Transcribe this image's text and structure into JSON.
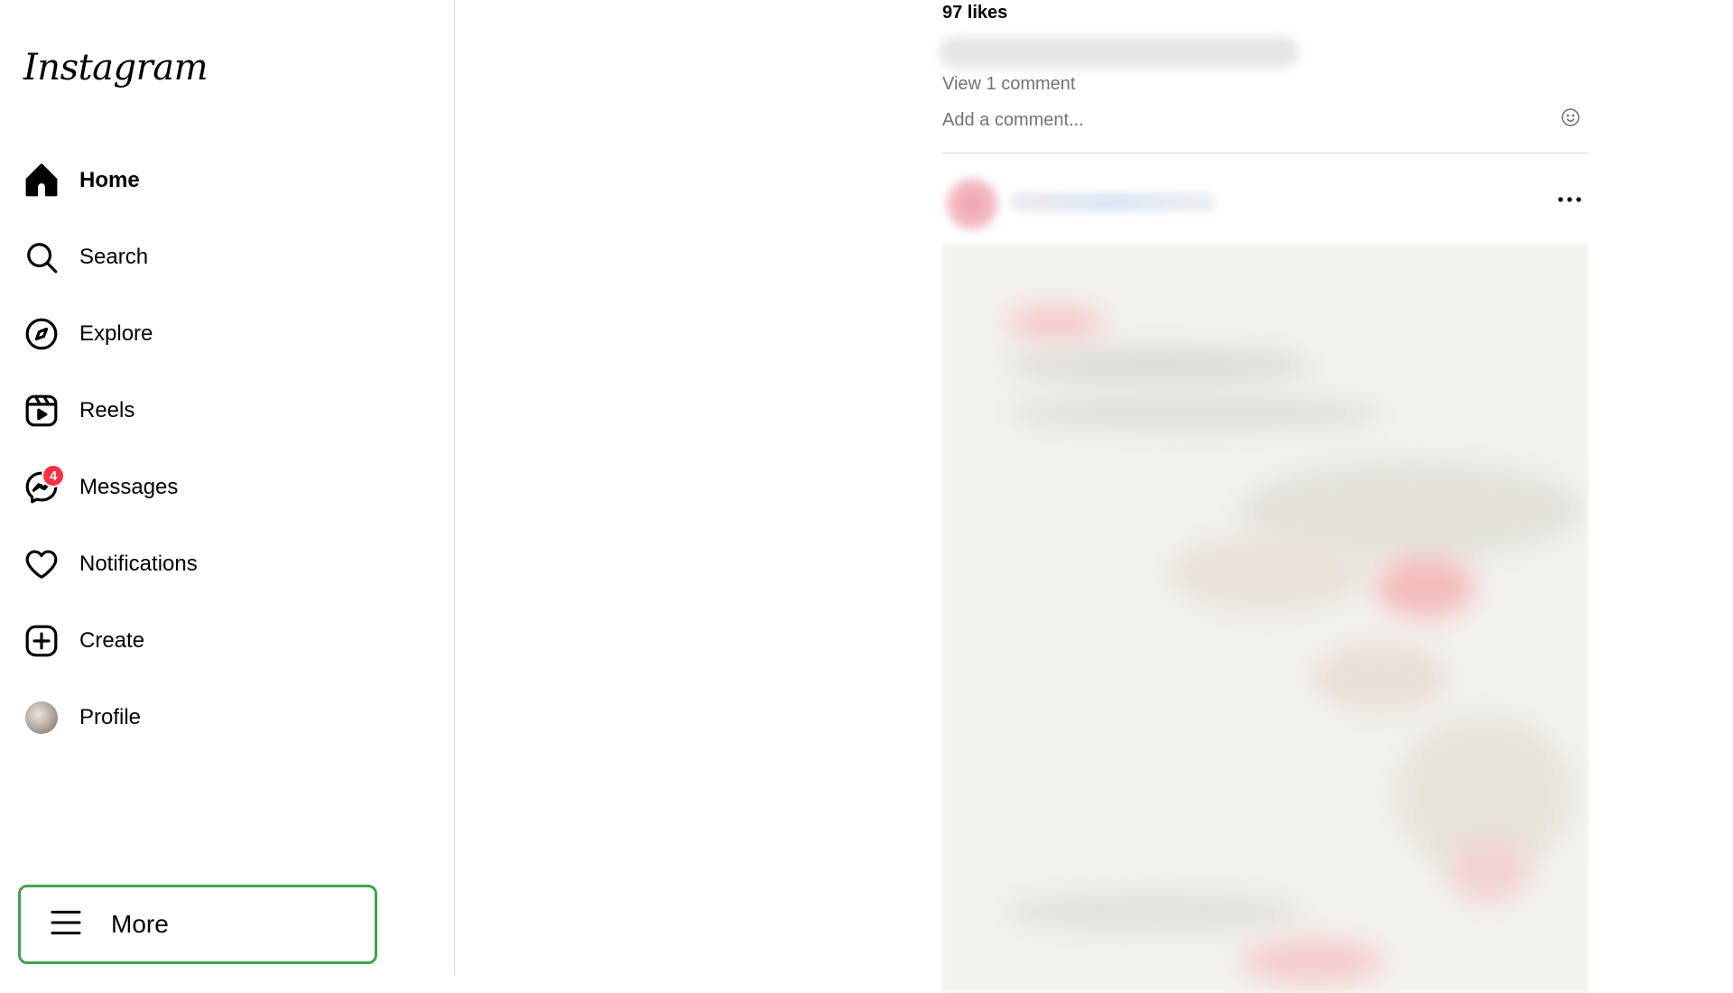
{
  "sidebar": {
    "logo": "Instagram",
    "items": [
      {
        "label": "Home",
        "icon": "home-icon",
        "active": true
      },
      {
        "label": "Search",
        "icon": "search-icon"
      },
      {
        "label": "Explore",
        "icon": "compass-icon"
      },
      {
        "label": "Reels",
        "icon": "reels-icon"
      },
      {
        "label": "Messages",
        "icon": "messenger-icon",
        "badge": "4"
      },
      {
        "label": "Notifications",
        "icon": "heart-icon"
      },
      {
        "label": "Create",
        "icon": "plus-square-icon"
      },
      {
        "label": "Profile",
        "icon": "avatar"
      }
    ],
    "more_label": "More"
  },
  "post_footer": {
    "likes": "97 likes",
    "view_comments": "View 1 comment",
    "comment_placeholder": "Add a comment..."
  },
  "colors": {
    "badge": "#ff3040",
    "more_highlight": "#3fa34d",
    "muted_text": "#737373",
    "divider": "#dbdbdb"
  }
}
